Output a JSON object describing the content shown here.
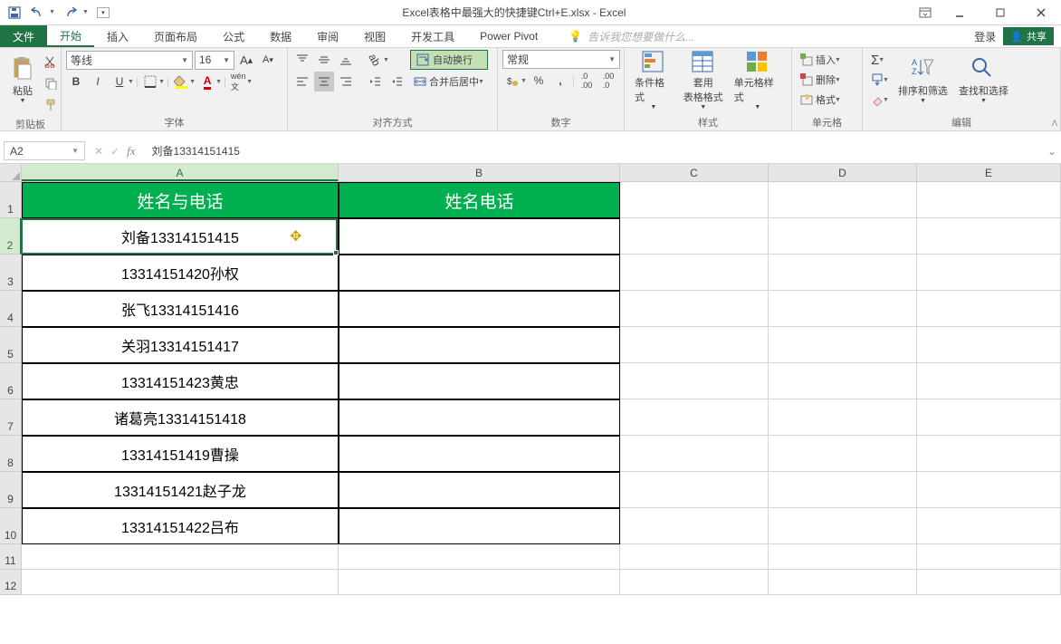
{
  "window": {
    "title": "Excel表格中最强大的快捷键Ctrl+E.xlsx - Excel"
  },
  "tabs": {
    "file": "文件",
    "home": "开始",
    "insert": "插入",
    "layout": "页面布局",
    "formulas": "公式",
    "data": "数据",
    "review": "审阅",
    "view": "视图",
    "dev": "开发工具",
    "pivot": "Power Pivot",
    "tellme": "告诉我您想要做什么...",
    "login": "登录",
    "share": "共享"
  },
  "ribbon": {
    "clipboard": {
      "paste": "粘贴",
      "label": "剪贴板"
    },
    "font": {
      "name": "等线",
      "size": "16",
      "label": "字体"
    },
    "align": {
      "wrap": "自动换行",
      "merge": "合并后居中",
      "label": "对齐方式"
    },
    "number": {
      "fmt": "常规",
      "label": "数字"
    },
    "styles": {
      "cond": "条件格式",
      "table": "套用\n表格格式",
      "cell": "单元格样式",
      "label": "样式"
    },
    "cells": {
      "insert": "插入",
      "delete": "删除",
      "format": "格式",
      "label": "单元格"
    },
    "edit": {
      "sort": "排序和筛选",
      "find": "查找和选择",
      "label": "编辑"
    }
  },
  "namebox": "A2",
  "formula": "刘备13314151415",
  "sheet": {
    "header_a": "姓名与电话",
    "header_b": "姓名电话",
    "rows": [
      "刘备13314151415",
      "13314151420孙权",
      "张飞13314151416",
      "关羽13314151417",
      "13314151423黄忠",
      "诸葛亮13314151418",
      "13314151419曹操",
      "13314151421赵子龙",
      "13314151422吕布"
    ]
  }
}
